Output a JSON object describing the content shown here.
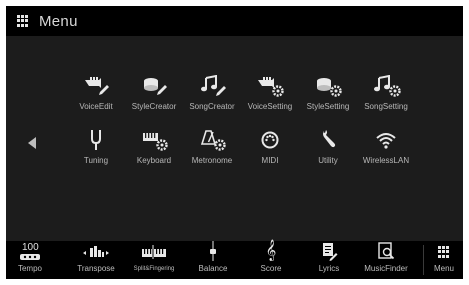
{
  "header": {
    "title": "Menu"
  },
  "apps": [
    {
      "label": "VoiceEdit",
      "icon": "trumpet-edit-icon"
    },
    {
      "label": "StyleCreator",
      "icon": "drum-edit-icon"
    },
    {
      "label": "SongCreator",
      "icon": "note-edit-icon"
    },
    {
      "label": "VoiceSetting",
      "icon": "trumpet-gear-icon"
    },
    {
      "label": "StyleSetting",
      "icon": "drum-gear-icon"
    },
    {
      "label": "SongSetting",
      "icon": "note-gear-icon"
    },
    {
      "label": "Tuning",
      "icon": "tuning-fork-icon"
    },
    {
      "label": "Keyboard",
      "icon": "keyboard-gear-icon"
    },
    {
      "label": "Metronome",
      "icon": "metronome-gear-icon"
    },
    {
      "label": "MIDI",
      "icon": "midi-icon"
    },
    {
      "label": "Utility",
      "icon": "wrench-icon"
    },
    {
      "label": "WirelessLAN",
      "icon": "wifi-icon"
    }
  ],
  "bottom": {
    "tempo_value": "100",
    "items": [
      {
        "label": "Tempo"
      },
      {
        "label": "Transpose"
      },
      {
        "label": "Split&Fingering"
      },
      {
        "label": "Balance"
      },
      {
        "label": "Score"
      },
      {
        "label": "Lyrics"
      },
      {
        "label": "MusicFinder"
      },
      {
        "label": "Menu"
      }
    ]
  },
  "colors": {
    "background": "#1c1c1c",
    "bar": "#000000",
    "text": "#b8b8b8"
  }
}
